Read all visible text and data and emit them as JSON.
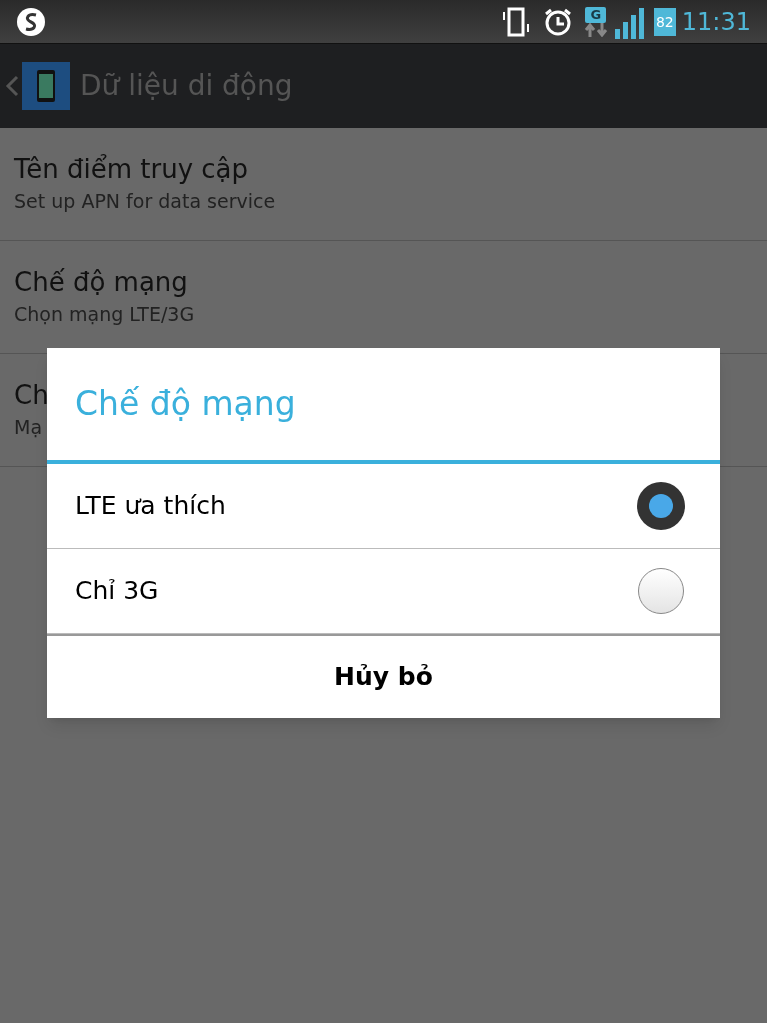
{
  "status_bar": {
    "battery": "82",
    "network": "G",
    "time": "11:31"
  },
  "action_bar": {
    "title": "Dữ liệu di động"
  },
  "settings": [
    {
      "title": "Tên điểm truy cập",
      "subtitle": "Set up APN for data service"
    },
    {
      "title": "Chế độ mạng",
      "subtitle": "Chọn mạng LTE/3G"
    },
    {
      "title": "Ch",
      "subtitle": "Mạ"
    }
  ],
  "dialog": {
    "title": "Chế độ mạng",
    "options": [
      {
        "label": "LTE ưa thích",
        "selected": true
      },
      {
        "label": "Chỉ 3G",
        "selected": false
      }
    ],
    "button": "Hủy bỏ"
  }
}
